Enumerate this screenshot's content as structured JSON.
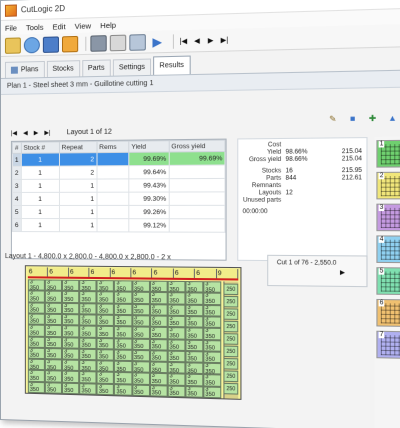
{
  "window": {
    "title": "CutLogic 2D"
  },
  "menu": [
    "File",
    "Tools",
    "Edit",
    "View",
    "Help"
  ],
  "toolbar": {
    "nav_first": "|◀",
    "nav_prev": "◀",
    "nav_next": "▶",
    "nav_last": "▶|"
  },
  "tabs": [
    {
      "label": "Plans"
    },
    {
      "label": "Stocks"
    },
    {
      "label": "Parts"
    },
    {
      "label": "Settings"
    },
    {
      "label": "Results",
      "active": true
    }
  ],
  "plan_bar": "Plan 1 - Steel sheet 3 mm - Guillotine cutting 1",
  "layout_nav": {
    "label": "Layout 1 of 12"
  },
  "grid": {
    "headers": [
      "#",
      "Stock #",
      "Repeat",
      "Rems",
      "Yield",
      "Gross yield"
    ],
    "rows": [
      {
        "n": "1",
        "stock": "1",
        "repeat": "2",
        "rems": "",
        "yield": "99.69%",
        "gross": "99.69%",
        "selected": true
      },
      {
        "n": "2",
        "stock": "1",
        "repeat": "2",
        "rems": "",
        "yield": "99.64%",
        "gross": "",
        "selected": false
      },
      {
        "n": "3",
        "stock": "1",
        "repeat": "1",
        "rems": "",
        "yield": "99.43%",
        "gross": "",
        "selected": false
      },
      {
        "n": "4",
        "stock": "1",
        "repeat": "1",
        "rems": "",
        "yield": "99.30%",
        "gross": "",
        "selected": false
      },
      {
        "n": "5",
        "stock": "1",
        "repeat": "1",
        "rems": "",
        "yield": "99.26%",
        "gross": "",
        "selected": false
      },
      {
        "n": "6",
        "stock": "1",
        "repeat": "1",
        "rems": "",
        "yield": "99.12%",
        "gross": "",
        "selected": false
      }
    ]
  },
  "stats": {
    "cost_label": "Cost",
    "yield_label": "Yield",
    "yield_pct": "98.66%",
    "yield_val": "215.04",
    "gross_label": "Gross yield",
    "gross_pct": "98.66%",
    "gross_val": "215.04",
    "stocks_label": "Stocks",
    "stocks_count": "16",
    "stocks_val": "215.95",
    "parts_label": "Parts",
    "parts_count": "844",
    "parts_val": "212.61",
    "remnants_label": "Remnants",
    "layouts_label": "Layouts",
    "layouts_count": "12",
    "unused_label": "Unused parts",
    "time": "00:00:00"
  },
  "layout_title": "Layout 1 - 4,800.0 x 2,800.0 - 4,800.0 x 2,800.0 - 2 x",
  "cut_box": {
    "label": "Cut 1 of 76 - 2,550.0",
    "arrow": "▶"
  },
  "sheet": {
    "top_labels": [
      "6",
      "6",
      "6",
      "6",
      "6",
      "6",
      "6",
      "6",
      "6",
      "9"
    ],
    "part_top": "350",
    "part_side": "250",
    "part_mark": "3\""
  },
  "thumbnails": [
    "1",
    "2",
    "3",
    "4",
    "5",
    "6",
    "7"
  ],
  "thumb_colors": [
    "#6fd06f",
    "#f0e67a",
    "#c49ae0",
    "#8fd0f0",
    "#7fe0b0",
    "#f0c070",
    "#b0b0f0"
  ],
  "colors": {
    "selection": "#3d8fe6",
    "yield_cell": "#8ee08e",
    "part_fill": "#b6e3a3",
    "sheet_fill": "#f7f39a",
    "cut_line": "#d21f1f"
  }
}
